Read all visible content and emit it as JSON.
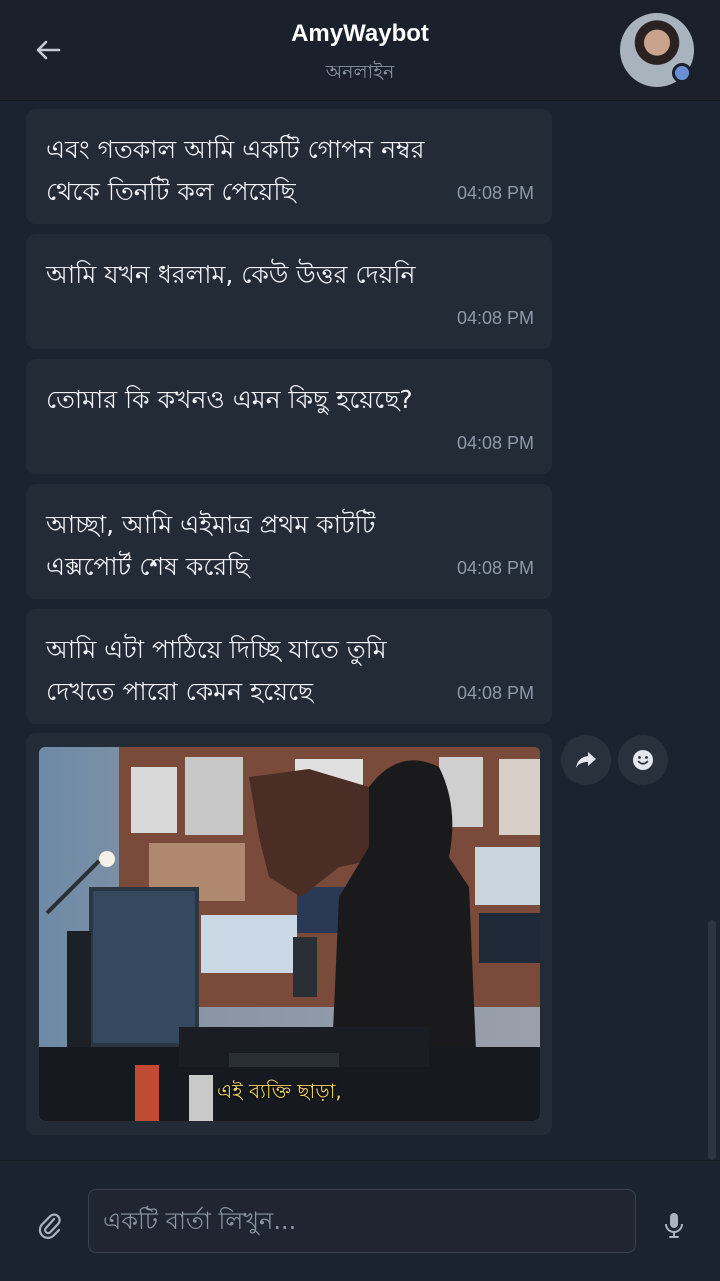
{
  "header": {
    "title": "AmyWaybot",
    "status": "অনলাইন"
  },
  "messages": [
    {
      "text": "এবং গতকাল আমি একটি গোপন নম্বর থেকে তিনটি কল পেয়েছি",
      "time": "04:08 PM"
    },
    {
      "text": "আমি যখন ধরলাম, কেউ উত্তর দেয়নি",
      "time": "04:08 PM"
    },
    {
      "text": "তোমার কি কখনও এমন কিছু হয়েছে?",
      "time": "04:08 PM"
    },
    {
      "text": "আচ্ছা, আমি এইমাত্র প্রথম কাটটি এক্সপোর্ট শেষ করেছি",
      "time": "04:08 PM"
    },
    {
      "text": "আমি এটা পাঠিয়ে দিচ্ছি যাতে তুমি দেখতে পারো কেমন হয়েছে",
      "time": "04:08 PM"
    }
  ],
  "image_message": {
    "caption": "এই ব্যক্তি ছাড়া,"
  },
  "composer": {
    "placeholder": "একটি বার্তা লিখুন..."
  },
  "icons": {
    "back": "arrow-left-icon",
    "forward": "forward-icon",
    "react": "smiley-icon",
    "attach": "paperclip-icon",
    "mic": "microphone-icon"
  },
  "colors": {
    "background": "#1c2330",
    "bubble": "#232b37",
    "online": "#6b8fd6",
    "caption": "#f4d35e"
  }
}
